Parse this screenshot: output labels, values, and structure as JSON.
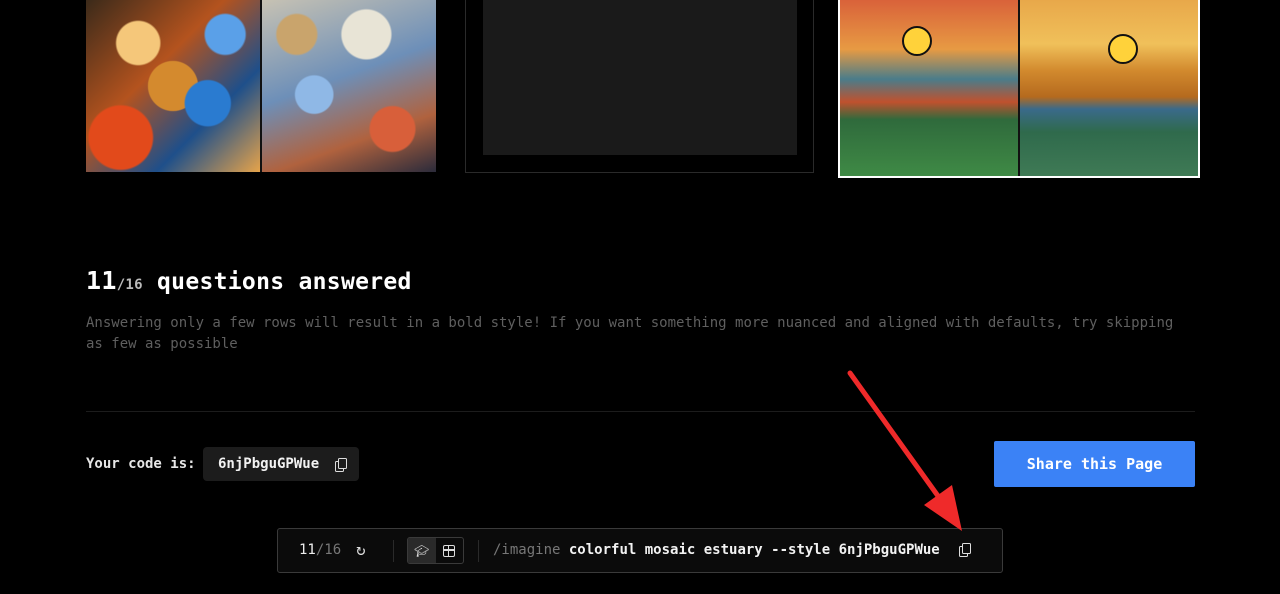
{
  "progress": {
    "answered": "11",
    "total": "/16",
    "label": " questions answered",
    "answered_value": 11,
    "total_value": 16
  },
  "subtitle": "Answering only a few rows will result in a bold style! If you want something more nuanced and aligned with defaults, try skipping as few as possible",
  "code_section": {
    "label": "Your code is:",
    "code": "6njPbguGPWue",
    "copy_icon": "copy-icon"
  },
  "share_button": {
    "label": "Share this Page",
    "color": "#3b82f6"
  },
  "bottom_bar": {
    "count": "11",
    "total": "/16",
    "refresh_icon": "refresh-icon",
    "mode_icons": [
      "graduation-cap-icon",
      "grid-icon"
    ],
    "command": "/imagine",
    "prompt_text": " colorful mosaic estuary --style 6njPbguGPWue",
    "copy_icon": "copy-icon"
  },
  "colors": {
    "background": "#000000",
    "annotation_arrow": "#ef2a2a"
  }
}
